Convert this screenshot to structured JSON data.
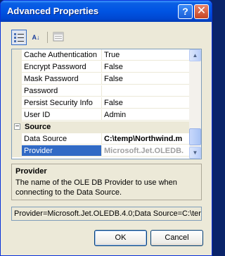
{
  "window": {
    "title": "Advanced Properties",
    "help_glyph": "?",
    "close_glyph": "✕"
  },
  "toolbar": {
    "categorized_icon": "categorized-icon",
    "alphabetical_icon": "alphabetical-icon",
    "property_pages_icon": "property-pages-icon",
    "alphabetical_glyph": "A↓"
  },
  "grid": {
    "rows": [
      {
        "name": "Cache Authentication",
        "value": "True"
      },
      {
        "name": "Encrypt Password",
        "value": "False"
      },
      {
        "name": "Mask Password",
        "value": "False"
      },
      {
        "name": "Password",
        "value": ""
      },
      {
        "name": "Persist Security Info",
        "value": "False"
      },
      {
        "name": "User ID",
        "value": "Admin"
      }
    ],
    "category": {
      "label": "Source",
      "toggle": "−"
    },
    "source_rows": [
      {
        "name": "Data Source",
        "value": "C:\\temp\\Northwind.m"
      },
      {
        "name": "Provider",
        "value": "Microsoft.Jet.OLEDB."
      }
    ],
    "scroll_up": "▲",
    "scroll_down": "▼"
  },
  "description": {
    "title": "Provider",
    "text": "The name of the OLE DB Provider to use when connecting to the Data Source."
  },
  "connection_string": "Provider=Microsoft.Jet.OLEDB.4.0;Data Source=C:\\ter",
  "buttons": {
    "ok": "OK",
    "cancel": "Cancel"
  }
}
